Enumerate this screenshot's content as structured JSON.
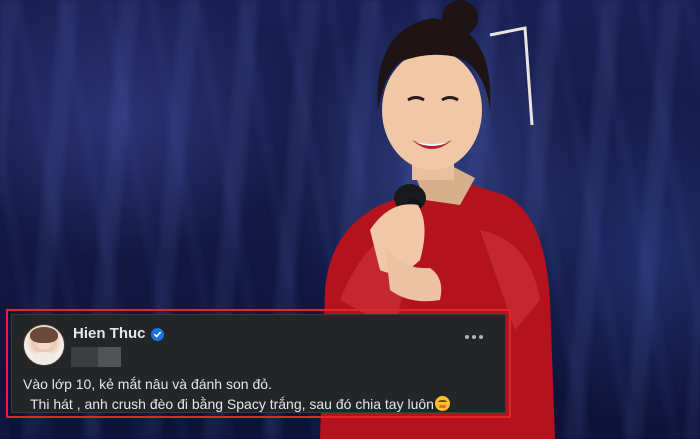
{
  "post": {
    "author": "Hien Thuc",
    "verified_icon": "verified-badge-icon",
    "lines": [
      "Vào lớp 10, kẻ mắt nâu và đánh son đỏ.",
      "Thi hát , anh crush đèo đi bằng Spacy trắng, sau đó chia tay luôn"
    ],
    "emoji": "smiling-face-with-hand-over-mouth-emoji",
    "more_icon": "more-options-icon"
  },
  "colors": {
    "highlight_border": "#e0252b",
    "card_background": "#242526",
    "text": "#e4e6eb",
    "verified_blue": "#1b74e4"
  }
}
